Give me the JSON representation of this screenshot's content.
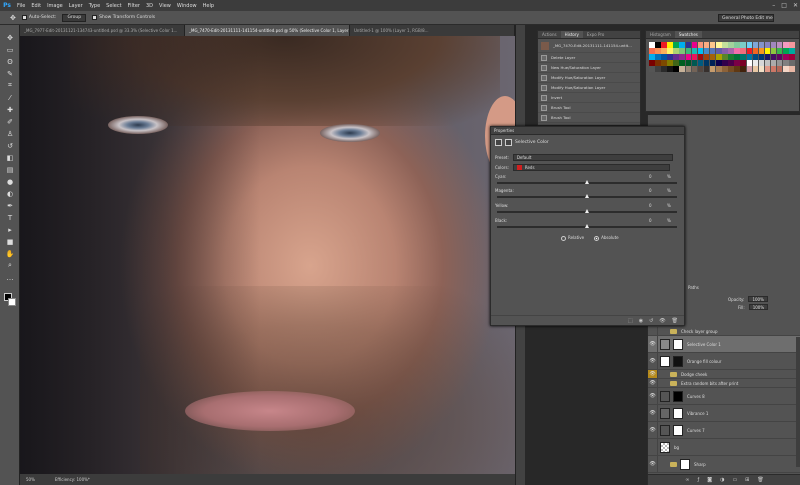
{
  "app": {
    "logo": "Ps"
  },
  "menu": [
    "File",
    "Edit",
    "Image",
    "Layer",
    "Type",
    "Select",
    "Filter",
    "3D",
    "View",
    "Window",
    "Help"
  ],
  "window_controls": [
    "–",
    "□",
    "✕"
  ],
  "options": {
    "auto_select_label": "Auto-Select:",
    "auto_select_value": "Group",
    "transform_label": "Show Transform Controls",
    "workspace": "General Photo Edit me"
  },
  "tabs": [
    "_MG_7977-Edit-20131121-134743-untitled.psd @ 33.3% (Selective Color 1...",
    "_MG_7470-Edit-20131111-141154-untitled.psd @ 50% (Selective Color 1, Layer Mask/16) *",
    "Untitled-1 @ 100% (Layer 1, RGB/8..."
  ],
  "status": {
    "zoom": "50%",
    "efficiency": "Efficiency: 100%*"
  },
  "history": {
    "tabs": [
      "Actions",
      "History",
      "Expo Pro"
    ],
    "snapshot": "_MG_7470-Edit-20131111-141154-untit...",
    "items": [
      "Delete Layer",
      "New Hue/Saturation Layer",
      "Modify Hue/Saturation Layer",
      "Modify Hue/Saturation Layer",
      "Invert",
      "Brush Tool",
      "Brush Tool"
    ]
  },
  "swatches": {
    "tabs": [
      "Histogram",
      "Swatches"
    ],
    "colors": [
      "#ffffff",
      "#000000",
      "#ed1c24",
      "#fff200",
      "#00a651",
      "#00aeef",
      "#2e3192",
      "#ec008c",
      "#f7977a",
      "#fbad82",
      "#fdc68c",
      "#fff799",
      "#c4df9b",
      "#a3d39c",
      "#82ca9c",
      "#7bcdc8",
      "#6ecff6",
      "#7ea7d8",
      "#8493ca",
      "#8882be",
      "#a187be",
      "#bc8dbf",
      "#f49ac1",
      "#f5989d",
      "#f26c4f",
      "#f68e56",
      "#fbaf5c",
      "#fff467",
      "#acd372",
      "#7cc576",
      "#3bb878",
      "#1abbb4",
      "#00bff3",
      "#438ccb",
      "#5574b9",
      "#605ca9",
      "#855fa8",
      "#a763a9",
      "#f06eaa",
      "#f26d7d",
      "#ed1c24",
      "#f26522",
      "#f7941d",
      "#fff200",
      "#8dc63f",
      "#39b54a",
      "#00a651",
      "#00a99d",
      "#00aeef",
      "#0072bc",
      "#0054a5",
      "#2e3192",
      "#662d91",
      "#92278f",
      "#ec008c",
      "#ed145b",
      "#9e0b0f",
      "#a0410d",
      "#a36209",
      "#aba000",
      "#598527",
      "#197b30",
      "#007236",
      "#00746b",
      "#0076a3",
      "#004a80",
      "#003471",
      "#1b1464",
      "#440e62",
      "#630460",
      "#9e005d",
      "#9e0039",
      "#790000",
      "#7b2e00",
      "#7d4900",
      "#827b00",
      "#406618",
      "#005e20",
      "#005826",
      "#005952",
      "#005b7f",
      "#003663",
      "#002157",
      "#0d004c",
      "#32004b",
      "#4b0049",
      "#7b0046",
      "#7a0026",
      "#ffffff",
      "#ebebeb",
      "#d7d7d7",
      "#c2c2c2",
      "#ababab",
      "#959595",
      "#808080",
      "#6b6b6b",
      "#555555",
      "#404040",
      "#2b2b2b",
      "#151515",
      "#000000",
      "#c7b299",
      "#998675",
      "#736357",
      "#534741",
      "#37302d",
      "#c69c6d",
      "#a67c52",
      "#8c6239",
      "#754c24",
      "#603913",
      "#42210b",
      "#d3a1a8",
      "#e8c7a3",
      "#f3e1c7",
      "#e29a89",
      "#cc7766",
      "#b26758",
      "#f4d5c5",
      "#e9b8a6"
    ]
  },
  "properties": {
    "header": "Properties",
    "title": "Selective Color",
    "preset_label": "Preset:",
    "preset_value": "Default",
    "colors_label": "Colors:",
    "colors_value": "Reds",
    "sliders": [
      {
        "label": "Cyan:",
        "value": "0",
        "pct": "%"
      },
      {
        "label": "Magenta:",
        "value": "0",
        "pct": "%"
      },
      {
        "label": "Yellow:",
        "value": "0",
        "pct": "%"
      },
      {
        "label": "Black:",
        "value": "0",
        "pct": "%"
      }
    ],
    "method_relative": "Relative",
    "method_absolute": "Absolute"
  },
  "layers": {
    "opacity_label": "Opacity:",
    "opacity_value": "100%",
    "fill_label": "Fill:",
    "fill_value": "100%",
    "paths_tab": "Paths",
    "items": [
      {
        "name": "Check layer group",
        "type": "group"
      },
      {
        "name": "Selective Color 1",
        "type": "adjust",
        "selected": true
      },
      {
        "name": "Orange fill colour",
        "type": "fill"
      },
      {
        "name": "Dodge cheek",
        "type": "group",
        "yellow": true
      },
      {
        "name": "Extra random bits after print",
        "type": "group"
      },
      {
        "name": "Curves 8",
        "type": "curves"
      },
      {
        "name": "Vibrance 1",
        "type": "vibrance"
      },
      {
        "name": "Curves 7",
        "type": "curves"
      },
      {
        "name": "bg",
        "type": "pixel"
      },
      {
        "name": "Sharp",
        "type": "group"
      }
    ]
  }
}
